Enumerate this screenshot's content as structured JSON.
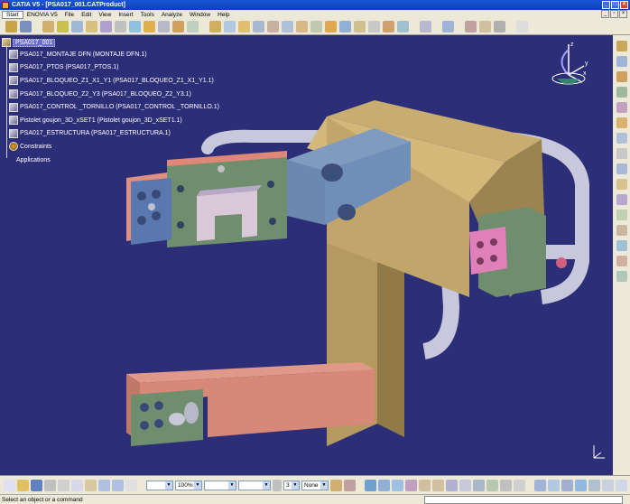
{
  "window": {
    "title": "CATIA V5 - [PSA017_001.CATProduct]"
  },
  "menubar": {
    "items": [
      "Start",
      "ENOVIA V5",
      "File",
      "Edit",
      "View",
      "Insert",
      "Tools",
      "Analyze",
      "Window",
      "Help"
    ]
  },
  "tree": {
    "root": "PSA017_001",
    "nodes": [
      {
        "label": "PSA017_MONTAJE DFN (MONTAJE DFN.1)",
        "icon": "product-icon"
      },
      {
        "label": "PSA017_PTOS (PSA017_PTOS.1)",
        "icon": "part-icon"
      },
      {
        "label": "PSA017_BLOQUEO_Z1_X1_Y1 (PSA017_BLOQUEO_Z1_X1_Y1.1)",
        "icon": "product-icon"
      },
      {
        "label": "PSA017_BLOQUEO_Z2_Y3 (PSA017_BLOQUEO_Z2_Y3.1)",
        "icon": "product-icon"
      },
      {
        "label": "PSA017_CONTROL _TORNILLO (PSA017_CONTROL _TORNILLO.1)",
        "icon": "product-icon"
      },
      {
        "label": "Pistolet goujon_3D_xSET1 (Pistolet goujon_3D_xSET1.1)",
        "icon": "product-icon"
      },
      {
        "label": "PSA017_ESTRUCTURA (PSA017_ESTRUCTURA.1)",
        "icon": "product-icon"
      },
      {
        "label": "Constraints",
        "icon": "constraints-icon"
      },
      {
        "label": "Applications",
        "icon": "applications-icon"
      }
    ]
  },
  "compass": {
    "z": "z",
    "y": "y",
    "x": "x"
  },
  "bottom_toolbar": {
    "zoom_value": "100%",
    "layer_value": "None",
    "number_value": "3"
  },
  "status": {
    "message": "Select an object or a command"
  },
  "colors": {
    "background": "#2d2e78",
    "body_tan": "#c4a66a",
    "plate_blue": "#6a8fb5",
    "plate_green": "#6e8c6c",
    "plate_salmon": "#d88a7a",
    "tube_grey": "#d0d0e0",
    "pink": "#e070b0"
  }
}
